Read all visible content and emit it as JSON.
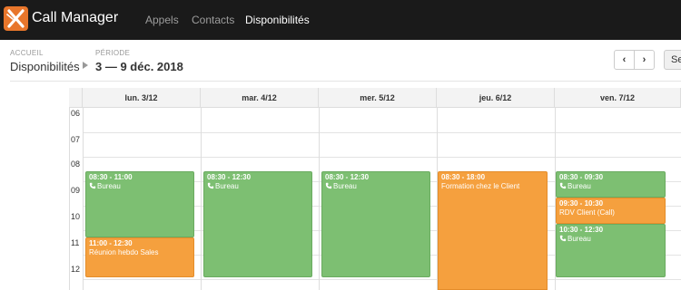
{
  "app": {
    "name": "Call Manager"
  },
  "nav": {
    "items": [
      {
        "label": "Appels"
      },
      {
        "label": "Contacts"
      },
      {
        "label": "Disponibilités"
      }
    ]
  },
  "breadcrumb": {
    "caption": "ACCUEIL",
    "title": "Disponibilités"
  },
  "period": {
    "caption": "PÉRIODE",
    "value": "3 — 9 déc. 2018"
  },
  "toolbar": {
    "week_label": "Se"
  },
  "calendar": {
    "days": [
      "lun. 3/12",
      "mar. 4/12",
      "mer. 5/12",
      "jeu. 6/12",
      "ven. 7/12"
    ],
    "hours": [
      "06",
      "07",
      "08",
      "09",
      "10",
      "11",
      "12"
    ],
    "events": [
      {
        "day": 0,
        "time": "08:30 - 11:00",
        "title": "Bureau",
        "kind": "call",
        "color": "#7dbf72"
      },
      {
        "day": 0,
        "time": "11:00 - 12:30",
        "title": "Réunion hebdo Sales",
        "kind": "meeting",
        "color": "#f5a03e"
      },
      {
        "day": 1,
        "time": "08:30 - 12:30",
        "title": "Bureau",
        "kind": "call",
        "color": "#7dbf72"
      },
      {
        "day": 2,
        "time": "08:30 - 12:30",
        "title": "Bureau",
        "kind": "call",
        "color": "#7dbf72"
      },
      {
        "day": 3,
        "time": "08:30 - 18:00",
        "title": "Formation chez le Client",
        "kind": "meeting",
        "color": "#f5a03e"
      },
      {
        "day": 4,
        "time": "08:30 - 09:30",
        "title": "Bureau",
        "kind": "call",
        "color": "#7dbf72"
      },
      {
        "day": 4,
        "time": "09:30 - 10:30",
        "title": "RDV Client (Call)",
        "kind": "meeting",
        "color": "#f5a03e"
      },
      {
        "day": 4,
        "time": "10:30 - 12:30",
        "title": "Bureau",
        "kind": "call",
        "color": "#7dbf72"
      }
    ]
  },
  "colors": {
    "navbar": "#1a1a1a",
    "brand_accent": "#e8762b",
    "available": "#7dbf72",
    "busy": "#f5a03e"
  }
}
